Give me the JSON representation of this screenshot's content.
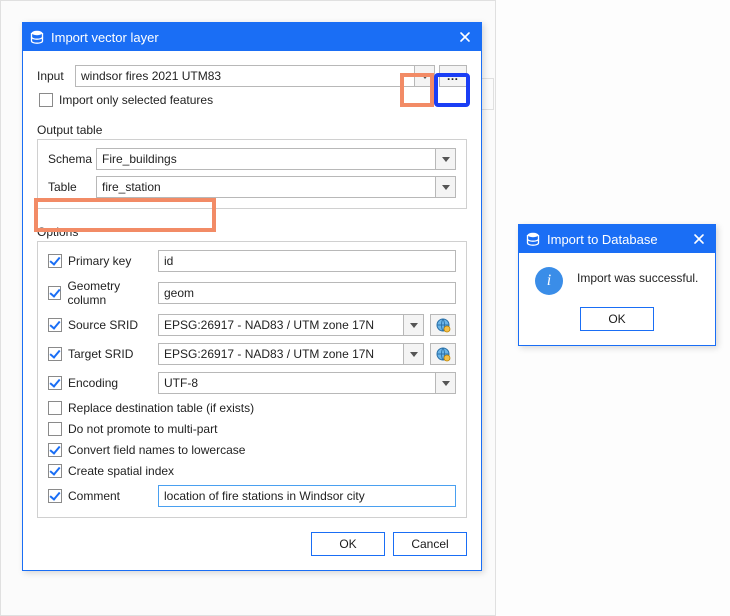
{
  "mainDialog": {
    "title": "Import vector layer",
    "input": {
      "label": "Input",
      "value": "windsor fires 2021 UTM83",
      "browse": "…"
    },
    "importOnlySelected": {
      "label": "Import only selected features",
      "checked": false
    },
    "outputTable": {
      "label": "Output table",
      "schema": {
        "label": "Schema",
        "value": "Fire_buildings"
      },
      "table": {
        "label": "Table",
        "value": "fire_station"
      }
    },
    "options": {
      "label": "Options",
      "primaryKey": {
        "label": "Primary key",
        "checked": true,
        "value": "id"
      },
      "geometryColumn": {
        "label": "Geometry column",
        "checked": true,
        "value": "geom"
      },
      "sourceSRID": {
        "label": "Source SRID",
        "checked": true,
        "value": "EPSG:26917 - NAD83 / UTM zone 17N"
      },
      "targetSRID": {
        "label": "Target SRID",
        "checked": true,
        "value": "EPSG:26917 - NAD83 / UTM zone 17N"
      },
      "encoding": {
        "label": "Encoding",
        "checked": true,
        "value": "UTF-8"
      },
      "replaceTable": {
        "label": "Replace destination table (if exists)",
        "checked": false
      },
      "noMultipart": {
        "label": "Do not promote to multi-part",
        "checked": false
      },
      "lowercase": {
        "label": "Convert field names to lowercase",
        "checked": true
      },
      "spatialIndex": {
        "label": "Create spatial index",
        "checked": true
      },
      "comment": {
        "label": "Comment",
        "checked": true,
        "value": "location of fire stations in Windsor city"
      }
    },
    "buttons": {
      "ok": "OK",
      "cancel": "Cancel"
    }
  },
  "messageBox": {
    "title": "Import to Database",
    "text": "Import was successful.",
    "ok": "OK"
  }
}
